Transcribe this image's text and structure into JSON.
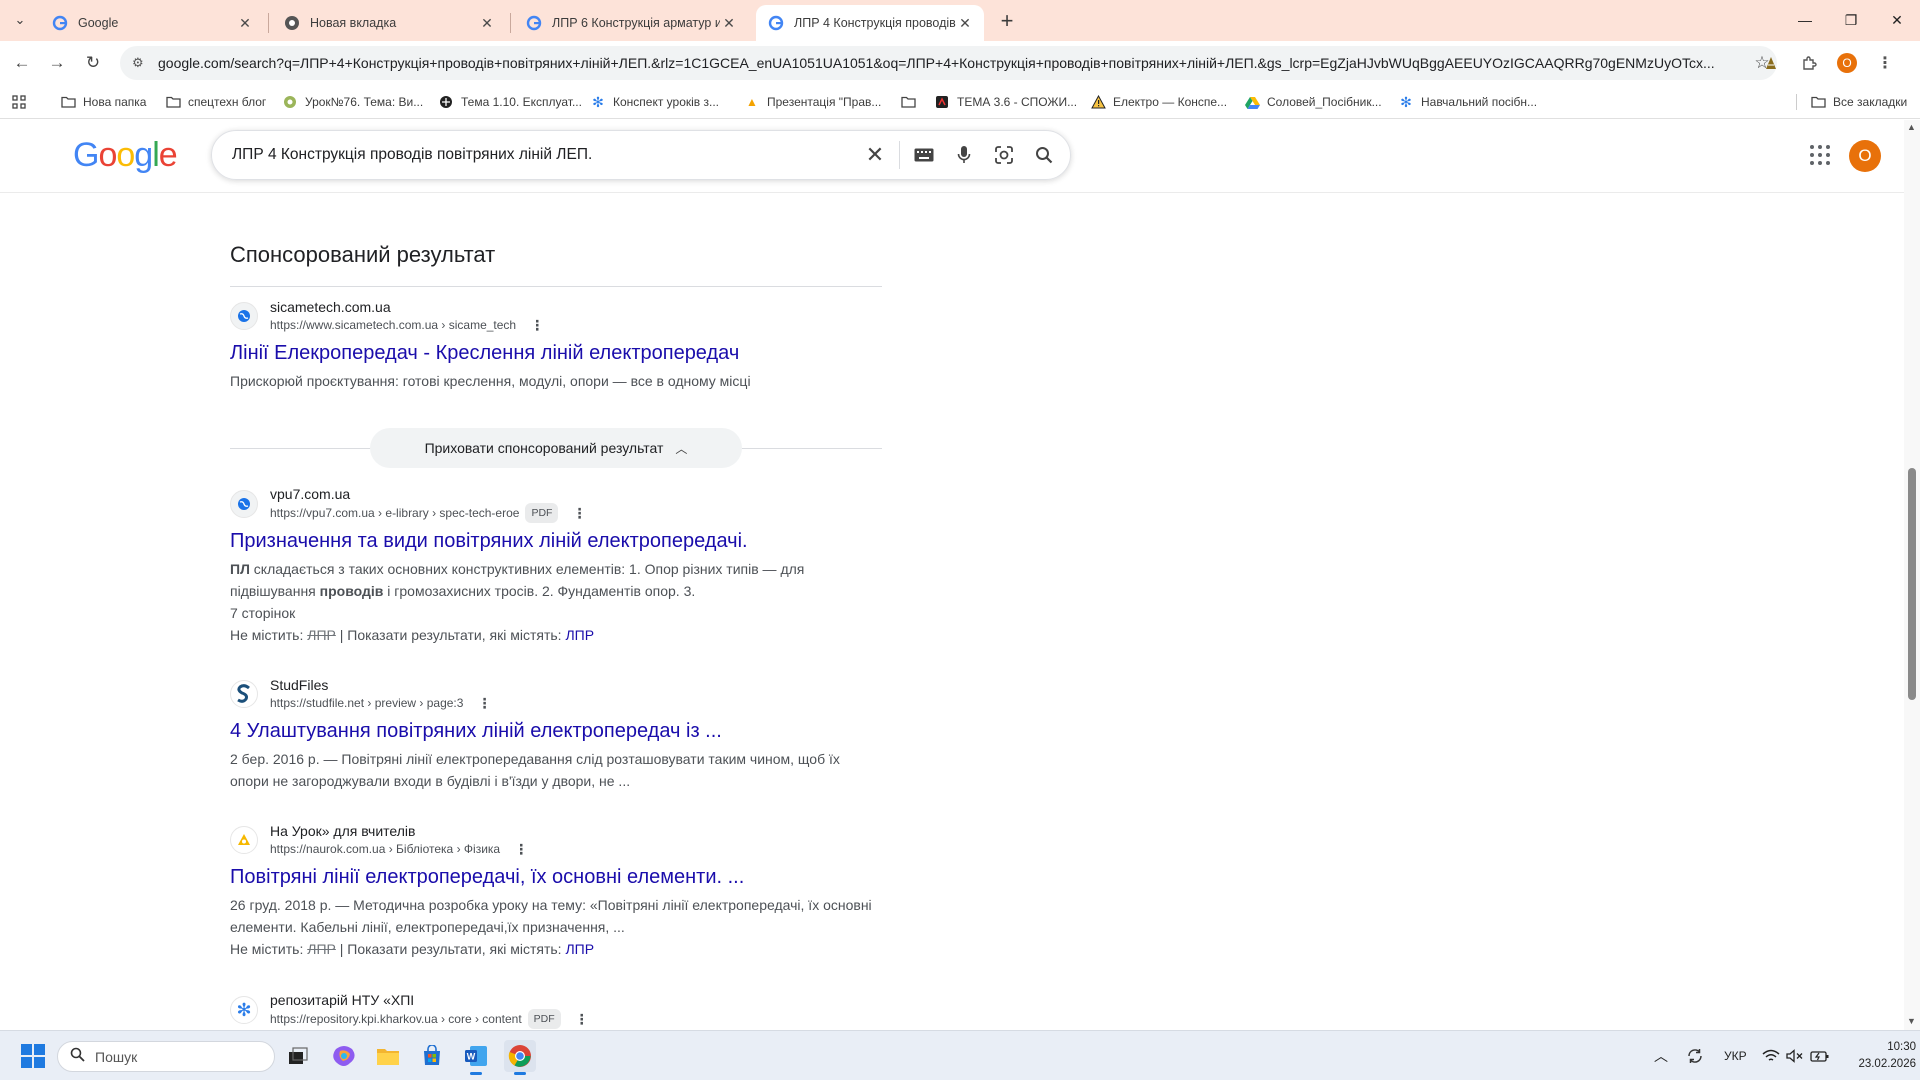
{
  "tabs": [
    {
      "title": "Google",
      "active": false
    },
    {
      "title": "Новая вкладка",
      "active": false
    },
    {
      "title": "ЛПР 6 Конструкція арматур и",
      "active": false
    },
    {
      "title": "ЛПР 4 Конструкція проводів п",
      "active": true
    }
  ],
  "window_controls": {
    "minimize": "—",
    "restore": "❐",
    "close": "✕"
  },
  "address_bar": {
    "url": "google.com/search?q=ЛПР+4+Конструкція+проводів+повітряних+ліній+ЛЕП.&rlz=1C1GCEA_enUA1051UA1051&oq=ЛПР+4+Конструкція+проводів+повітряних+ліній+ЛЕП.&gs_lcrp=EgZjaHJvbWUqBggAEEUYOzIGCAAQRRg70gENMzUyOTcx...",
    "profile_letter": "O"
  },
  "bookmarks": [
    {
      "label": "Нова папка",
      "icon": "folder-icon"
    },
    {
      "label": "спецтехн блог",
      "icon": "folder-icon"
    },
    {
      "label": "Урок№76. Тема: Ви...",
      "icon": "site-icon"
    },
    {
      "label": "Тема 1.10. Експлуат...",
      "icon": "site-icon"
    },
    {
      "label": "Конспект уроків з...",
      "icon": "site-icon"
    },
    {
      "label": "Презентація \"Прав...",
      "icon": "site-icon"
    },
    {
      "label": "",
      "icon": "folder-icon"
    },
    {
      "label": "ТЕМА 3.6 - СПОЖИ...",
      "icon": "site-icon"
    },
    {
      "label": "Електро — Конспе...",
      "icon": "warning-icon"
    },
    {
      "label": "Соловей_Посібник...",
      "icon": "drive-icon"
    },
    {
      "label": "Навчальний посібн...",
      "icon": "site-icon"
    },
    {
      "label": "Все закладки",
      "icon": "folder-icon"
    }
  ],
  "search": {
    "logo": "Google",
    "query": "ЛПР 4 Конструкція проводів повітряних ліній ЛЕП.",
    "avatar_letter": "O"
  },
  "sponsored": {
    "heading": "Спонсорований результат",
    "site_name": "sicametech.com.ua",
    "url": "https://www.sicametech.com.ua › sicame_tech",
    "title": "Лінії Елекропередач - Креслення ліній електропередач",
    "snippet": "Прискорюй проєктування: готові креслення, модулі, опори — все в одному місці",
    "hide_button": "Приховати спонсорований результат"
  },
  "results": [
    {
      "site_name": "vpu7.com.ua",
      "url": "https://vpu7.com.ua › e-library › spec-tech-eroe",
      "badge": "PDF",
      "title": "Призначення та види повітряних ліній електропередачі.",
      "snippet_b1": "ПЛ",
      "snippet_t1": " складається з таких основних конструктивних елементів: 1. Опор різних типів — для підвішування ",
      "snippet_b2": "проводів",
      "snippet_t2": " і громозахисних тросів. 2. Фундаментів опор. 3.",
      "pages": "7 сторінок",
      "missing_prefix": "Не містить: ",
      "missing_term": "ЛПР",
      "missing_mid": " | Показати результати, які містять: ",
      "missing_link": "ЛПР"
    },
    {
      "site_name": "StudFiles",
      "url": "https://studfile.net › preview › page:3",
      "title": "4 Улаштування повітряних ліній електропередач із ...",
      "snippet": "2 бер. 2016 р. — Повітряні лінії електропередавання слід розташовувати таким чином, щоб їх опори не загороджували входи в будівлі і в'їзди у двори, не ..."
    },
    {
      "site_name": "На Урок» для вчителів",
      "url": "https://naurok.com.ua › Бібліотека › Фізика",
      "title": "Повітряні лінії електропередачі, їх основні елементи. ...",
      "snippet": "26 груд. 2018 р. — Методична розробка уроку на тему: «Повітряні лінії електропередачі, їх основні елементи. Кабельні лінії, електропередачі,їх призначення, ...",
      "missing_prefix": "Не містить: ",
      "missing_term": "ЛПР",
      "missing_mid": " | Показати результати, які містять: ",
      "missing_link": "ЛПР"
    },
    {
      "site_name": "репозитарій НТУ «ХПІ",
      "url": "https://repository.kpi.kharkov.ua › core › content",
      "badge": "PDF"
    }
  ],
  "taskbar": {
    "search_placeholder": "Пошук",
    "language": "УКР",
    "time": "10:30",
    "date": "23.02.2026"
  },
  "colors": {
    "tabstrip": "#fde3d9",
    "link": "#1a0dab",
    "avatar": "#e8710a"
  }
}
